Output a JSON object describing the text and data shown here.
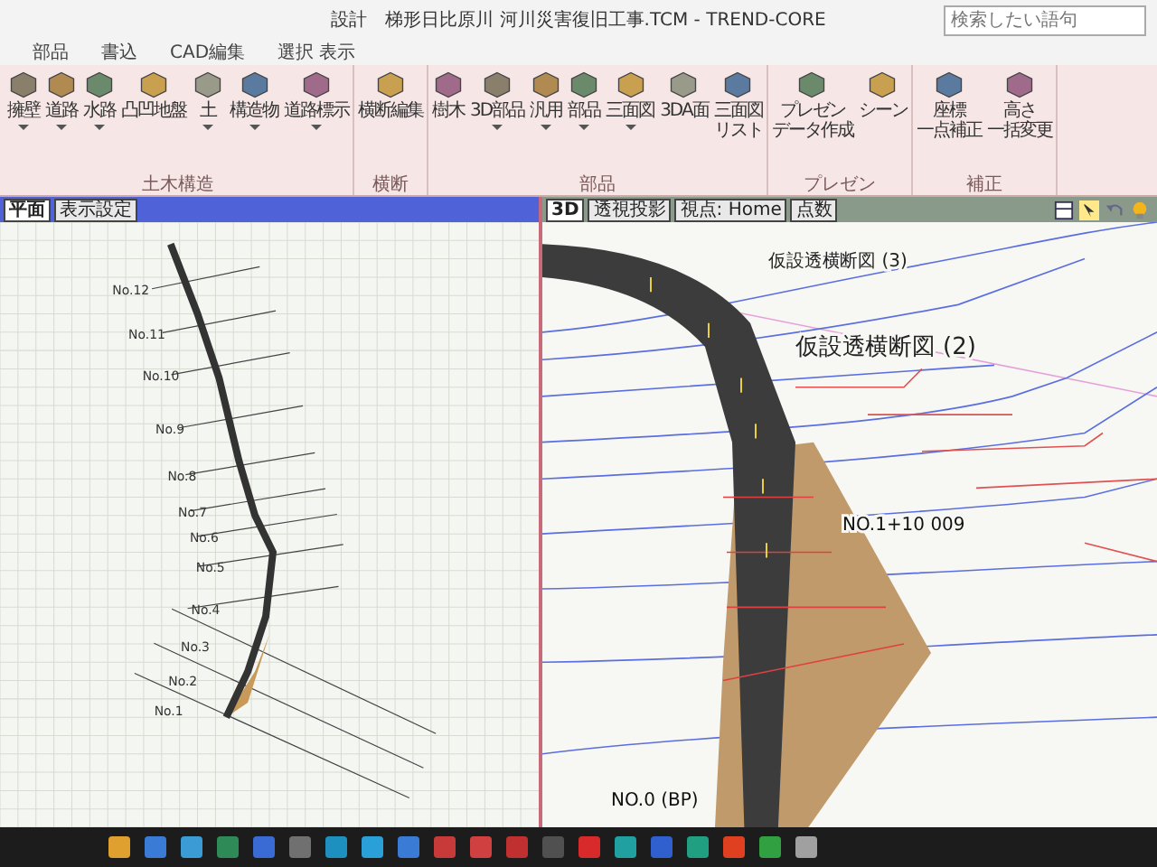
{
  "window": {
    "title": "設計　梯形日比原川 河川災害復旧工事.TCM - TREND-CORE",
    "search": {
      "placeholder": "検索したい語句"
    }
  },
  "menu_tabs": [
    {
      "label": "部品",
      "selected": false
    },
    {
      "label": "書込",
      "selected": false
    },
    {
      "label": "CAD編集",
      "selected": false
    },
    {
      "label": "選択 表示",
      "selected": false
    }
  ],
  "ribbon_groups": [
    {
      "label": "土木構造",
      "buttons": [
        {
          "label": "擁壁",
          "dropdown": true
        },
        {
          "label": "道路",
          "dropdown": true
        },
        {
          "label": "水路",
          "dropdown": true
        },
        {
          "label": "凸凹地盤",
          "dropdown": false
        },
        {
          "label": "土",
          "dropdown": true
        },
        {
          "label": "構造物",
          "dropdown": true
        },
        {
          "label": "道路標示",
          "dropdown": true
        }
      ]
    },
    {
      "label": "横断",
      "buttons": [
        {
          "label": "横断編集",
          "dropdown": false
        }
      ]
    },
    {
      "label": "部品",
      "buttons": [
        {
          "label": "樹木",
          "dropdown": false
        },
        {
          "label": "3D部品",
          "dropdown": true
        },
        {
          "label": "汎用",
          "dropdown": true
        },
        {
          "label": "部品",
          "dropdown": true
        },
        {
          "label": "三面図",
          "dropdown": true
        },
        {
          "label": "3DA面",
          "dropdown": false
        },
        {
          "lines": [
            "三面図",
            "リスト"
          ],
          "dropdown": false
        }
      ]
    },
    {
      "label": "プレゼン",
      "buttons": [
        {
          "lines": [
            "プレゼン",
            "データ作成"
          ],
          "dropdown": false
        },
        {
          "label": "シーン",
          "dropdown": false
        }
      ]
    },
    {
      "label": "補正",
      "buttons": [
        {
          "lines": [
            "座標",
            "一点補正"
          ],
          "dropdown": false
        },
        {
          "lines": [
            "高さ",
            "一括変更"
          ],
          "dropdown": false
        }
      ]
    }
  ],
  "left_view": {
    "tabs": [
      {
        "label": "平面",
        "selected": true
      },
      {
        "label": "表示設定",
        "selected": false
      }
    ],
    "station_labels": [
      "No.12",
      "No.11",
      "No.10",
      "No.9",
      "No.8",
      "No.7",
      "No.6",
      "No.5",
      "No.4",
      "No.3",
      "No.2",
      "No.1"
    ]
  },
  "right_view": {
    "tabs": [
      {
        "label": "3D",
        "selected": true
      },
      {
        "label": "透視投影",
        "selected": false
      },
      {
        "label": "視点: Home",
        "selected": false
      },
      {
        "label": "点数",
        "selected": false
      }
    ],
    "labels": [
      {
        "kind": "small",
        "text": "仮設透横断図 (3)"
      },
      {
        "kind": "large",
        "text": "仮設透横断図 (2)"
      },
      {
        "kind": "station",
        "text": "NO.1+10 009"
      },
      {
        "kind": "station",
        "text": "NO.0 (BP)"
      }
    ]
  },
  "taskbar": {
    "apps": [
      {
        "color": "#e0a030"
      },
      {
        "color": "#3a7bd5"
      },
      {
        "color": "#3a9bd5"
      },
      {
        "color": "#2e8b57"
      },
      {
        "color": "#3a6bd5"
      },
      {
        "color": "#707070"
      },
      {
        "color": "#1e90c0"
      },
      {
        "color": "#2aa0d8"
      },
      {
        "color": "#3a7bd5"
      },
      {
        "color": "#c83a3a"
      },
      {
        "color": "#d04040"
      },
      {
        "color": "#c03030"
      },
      {
        "color": "#505050"
      },
      {
        "color": "#d82a2a"
      },
      {
        "color": "#20a0a0"
      },
      {
        "color": "#3060d0"
      },
      {
        "color": "#20a080"
      },
      {
        "color": "#e04020"
      },
      {
        "color": "#30a040"
      },
      {
        "color": "#a0a0a0"
      }
    ]
  }
}
